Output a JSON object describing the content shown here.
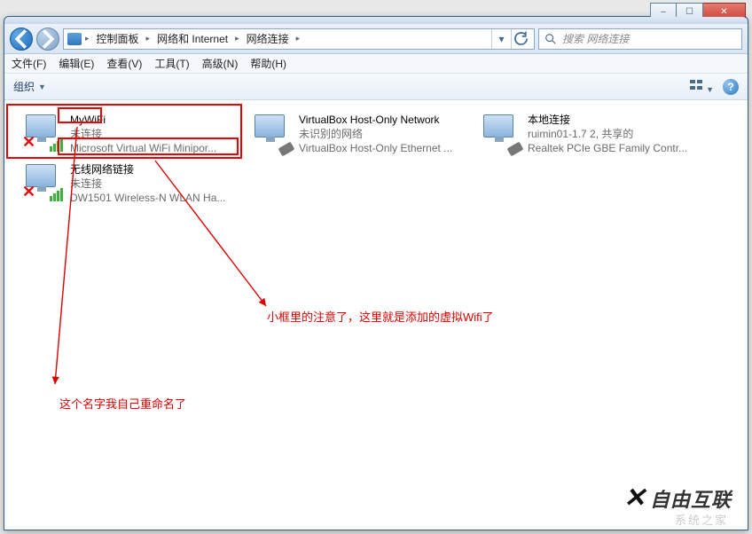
{
  "window_controls": {
    "min": "–",
    "max": "☐",
    "close": "✕"
  },
  "breadcrumbs": {
    "root_icon": "network-folder",
    "items": [
      "控制面板",
      "网络和 Internet",
      "网络连接"
    ]
  },
  "search": {
    "placeholder": "搜索 网络连接"
  },
  "menubar": {
    "file": "文件(F)",
    "edit": "编辑(E)",
    "view": "查看(V)",
    "tools": "工具(T)",
    "advanced": "高级(N)",
    "help": "帮助(H)"
  },
  "toolbar": {
    "organize": "组织"
  },
  "connections": [
    {
      "name": "MyWiFi",
      "status": "未连接",
      "device": "Microsoft Virtual WiFi Minipor...",
      "icon_type": "wifi-disabled"
    },
    {
      "name": "VirtualBox Host-Only Network",
      "status": "未识别的网络",
      "device": "VirtualBox Host-Only Ethernet ...",
      "icon_type": "ethernet"
    },
    {
      "name": "本地连接",
      "status": "ruimin01-1.7  2, 共享的",
      "device": "Realtek PCIe GBE Family Contr...",
      "icon_type": "ethernet"
    },
    {
      "name": "无线网络链接",
      "status": "未连接",
      "device": "DW1501 Wireless-N WLAN Ha...",
      "icon_type": "wifi-disabled"
    }
  ],
  "annotations": {
    "note1": "小框里的注意了，这里就是添加的虚拟Wifi了",
    "note2": "这个名字我自己重命名了"
  },
  "watermark": {
    "main": "自由互联",
    "sub": "系统之家"
  }
}
